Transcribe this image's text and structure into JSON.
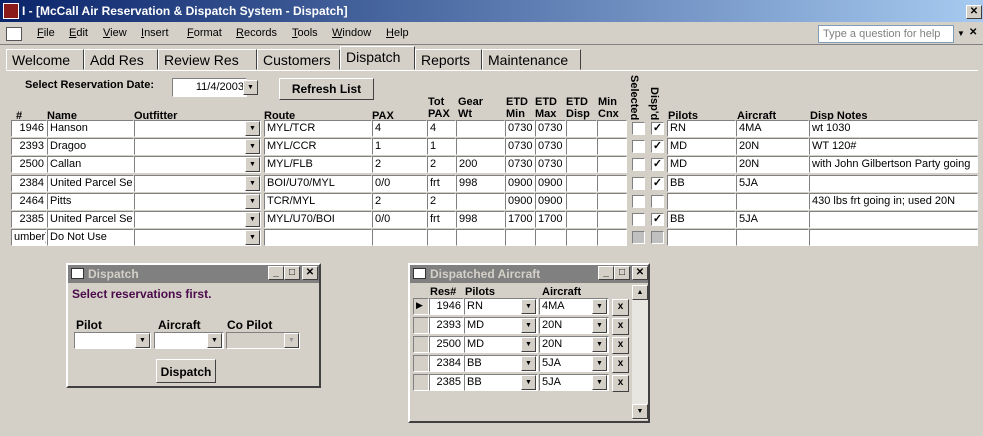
{
  "window": {
    "title": "I - [McCall Air Reservation & Dispatch System - Dispatch]"
  },
  "menu": [
    "File",
    "Edit",
    "View",
    "Insert",
    "Format",
    "Records",
    "Tools",
    "Window",
    "Help"
  ],
  "help_placeholder": "Type a question for help",
  "tabs": [
    "Welcome",
    "Add Res",
    "Review Res",
    "Customers",
    "Dispatch",
    "Reports",
    "Maintenance"
  ],
  "active_tab": "Dispatch",
  "filter": {
    "label": "Select Reservation Date:",
    "date": "11/4/2003",
    "refresh_label": "Refresh List"
  },
  "columns": {
    "num": "#",
    "name": "Name",
    "outfitter": "Outfitter",
    "route": "Route",
    "pax": "PAX",
    "tot_pax": "Tot PAX",
    "gear_wt": "Gear Wt",
    "etd_min": "ETD Min",
    "etd_max": "ETD Max",
    "etd_disp": "ETD Disp",
    "min_cnx": "Min Cnx",
    "selected": "Selected",
    "dispd": "Disp'd",
    "pilots": "Pilots",
    "aircraft": "Aircraft",
    "disp_notes": "Disp Notes"
  },
  "rows": [
    {
      "num": "1946",
      "name": "Hanson",
      "outfitter": "",
      "route": "MYL/TCR",
      "pax": "4",
      "tot_pax": "4",
      "gear": "",
      "etd_min": "0730",
      "etd_max": "0730",
      "etd_disp": "",
      "min_cnx": "",
      "selected": false,
      "dispd": true,
      "pilots": "RN",
      "aircraft": "4MA",
      "notes": "wt 1030"
    },
    {
      "num": "2393",
      "name": "Dragoo",
      "outfitter": "",
      "route": "MYL/CCR",
      "pax": "1",
      "tot_pax": "1",
      "gear": "",
      "etd_min": "0730",
      "etd_max": "0730",
      "etd_disp": "",
      "min_cnx": "",
      "selected": false,
      "dispd": true,
      "pilots": "MD",
      "aircraft": "20N",
      "notes": "WT 120#"
    },
    {
      "num": "2500",
      "name": "Callan",
      "outfitter": "",
      "route": "MYL/FLB",
      "pax": "2",
      "tot_pax": "2",
      "gear": "200",
      "etd_min": "0730",
      "etd_max": "0730",
      "etd_disp": "",
      "min_cnx": "",
      "selected": false,
      "dispd": true,
      "pilots": "MD",
      "aircraft": "20N",
      "notes": "with John Gilbertson Party going"
    },
    {
      "num": "2384",
      "name": "United Parcel Se",
      "outfitter": "",
      "route": "BOI/U70/MYL",
      "pax": "0/0",
      "tot_pax": "frt",
      "gear": "998",
      "etd_min": "0900",
      "etd_max": "0900",
      "etd_disp": "",
      "min_cnx": "",
      "selected": false,
      "dispd": true,
      "pilots": "BB",
      "aircraft": "5JA",
      "notes": ""
    },
    {
      "num": "2464",
      "name": "Pitts",
      "outfitter": "",
      "route": "TCR/MYL",
      "pax": "2",
      "tot_pax": "2",
      "gear": "",
      "etd_min": "0900",
      "etd_max": "0900",
      "etd_disp": "",
      "min_cnx": "",
      "selected": false,
      "dispd": false,
      "pilots": "",
      "aircraft": "",
      "notes": "430 lbs frt going in; used 20N"
    },
    {
      "num": "2385",
      "name": "United Parcel Se",
      "outfitter": "",
      "route": "MYL/U70/BOI",
      "pax": "0/0",
      "tot_pax": "frt",
      "gear": "998",
      "etd_min": "1700",
      "etd_max": "1700",
      "etd_disp": "",
      "min_cnx": "",
      "selected": false,
      "dispd": true,
      "pilots": "BB",
      "aircraft": "5JA",
      "notes": ""
    },
    {
      "num": "umber)",
      "name": "Do Not Use",
      "outfitter": "",
      "route": "",
      "pax": "",
      "tot_pax": "",
      "gear": "",
      "etd_min": "",
      "etd_max": "",
      "etd_disp": "",
      "min_cnx": "",
      "selected": null,
      "dispd": null,
      "pilots": "",
      "aircraft": "",
      "notes": ""
    }
  ],
  "dispatch_dialog": {
    "title": "Dispatch",
    "message": "Select reservations first.",
    "pilot_label": "Pilot",
    "aircraft_label": "Aircraft",
    "copilot_label": "Co Pilot",
    "button": "Dispatch"
  },
  "dispatched_aircraft": {
    "title": "Dispatched Aircraft",
    "columns": {
      "res": "Res#",
      "pilots": "Pilots",
      "aircraft": "Aircraft"
    },
    "remove_label": "x",
    "rows": [
      {
        "res": "1946",
        "pilot": "RN",
        "aircraft": "4MA"
      },
      {
        "res": "2393",
        "pilot": "MD",
        "aircraft": "20N"
      },
      {
        "res": "2500",
        "pilot": "MD",
        "aircraft": "20N"
      },
      {
        "res": "2384",
        "pilot": "BB",
        "aircraft": "5JA"
      },
      {
        "res": "2385",
        "pilot": "BB",
        "aircraft": "5JA"
      }
    ]
  },
  "colors": {
    "titlebar": "#0a246a",
    "face": "#d4d0c8",
    "message": "#4b0b4b"
  }
}
